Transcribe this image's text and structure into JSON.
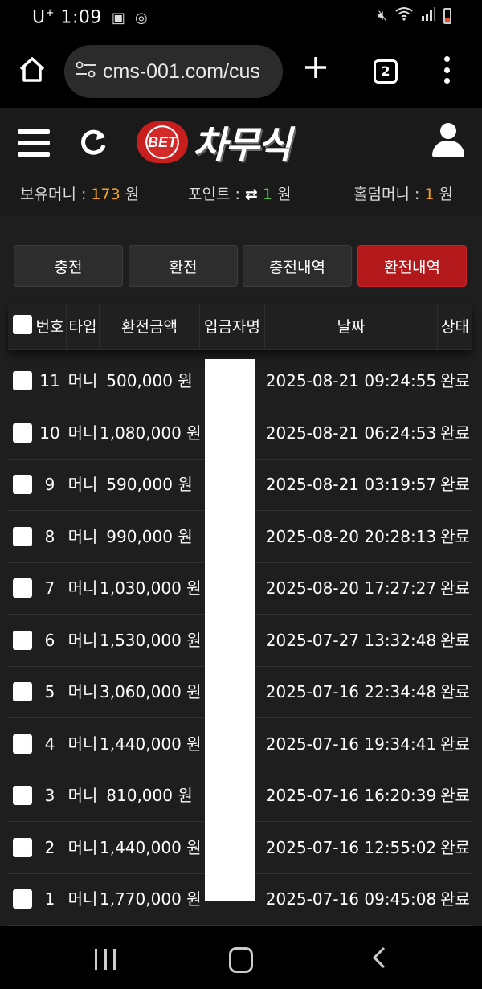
{
  "status_bar": {
    "carrier": "U",
    "carrier_sup": "+",
    "time": "1:09",
    "icons": [
      "image-icon",
      "sync-icon",
      "mute-icon",
      "wifi-icon",
      "signal-icon",
      "battery-icon"
    ]
  },
  "browser": {
    "url": "cms-001.com/cus",
    "tab_count": "2",
    "icons": [
      "home-icon",
      "site-settings-icon",
      "new-tab-icon",
      "tabs-icon",
      "more-menu-icon"
    ]
  },
  "site": {
    "logo_badge": "BET",
    "logo_name": "차무식",
    "balances": {
      "money_label": "보유머니 : ",
      "money_value": "173",
      "money_unit": " 원",
      "point_label": "포인트 : ",
      "point_swap": "⇄",
      "point_value": "1",
      "point_unit": " 원",
      "holdem_label": "홀덤머니 : ",
      "holdem_value": "1",
      "holdem_unit": " 원"
    }
  },
  "tabs": [
    {
      "label": "충전",
      "active": false
    },
    {
      "label": "환전",
      "active": false
    },
    {
      "label": "충전내역",
      "active": false
    },
    {
      "label": "환전내역",
      "active": true
    }
  ],
  "table": {
    "headers": [
      "번호",
      "타입",
      "환전금액",
      "입금자명",
      "날짜",
      "상태"
    ],
    "rows": [
      {
        "no": "11",
        "type": "머니",
        "amount": "500,000 원",
        "date": "2025-08-21 09:24:55",
        "status": "완료"
      },
      {
        "no": "10",
        "type": "머니",
        "amount": "1,080,000 원",
        "date": "2025-08-21 06:24:53",
        "status": "완료"
      },
      {
        "no": "9",
        "type": "머니",
        "amount": "590,000 원",
        "date": "2025-08-21 03:19:57",
        "status": "완료"
      },
      {
        "no": "8",
        "type": "머니",
        "amount": "990,000 원",
        "date": "2025-08-20 20:28:13",
        "status": "완료"
      },
      {
        "no": "7",
        "type": "머니",
        "amount": "1,030,000 원",
        "date": "2025-08-20 17:27:27",
        "status": "완료"
      },
      {
        "no": "6",
        "type": "머니",
        "amount": "1,530,000 원",
        "date": "2025-07-27 13:32:48",
        "status": "완료"
      },
      {
        "no": "5",
        "type": "머니",
        "amount": "3,060,000 원",
        "date": "2025-07-16 22:34:48",
        "status": "완료"
      },
      {
        "no": "4",
        "type": "머니",
        "amount": "1,440,000 원",
        "date": "2025-07-16 19:34:41",
        "status": "완료"
      },
      {
        "no": "3",
        "type": "머니",
        "amount": "810,000 원",
        "date": "2025-07-16 16:20:39",
        "status": "완료"
      },
      {
        "no": "2",
        "type": "머니",
        "amount": "1,440,000 원",
        "date": "2025-07-16 12:55:02",
        "status": "완료"
      },
      {
        "no": "1",
        "type": "머니",
        "amount": "1,770,000 원",
        "date": "2025-07-16 09:45:08",
        "status": "완료"
      }
    ]
  },
  "colors": {
    "accent_red": "#b3191b",
    "money_orange": "#f4a21a",
    "point_green": "#54c24a"
  }
}
